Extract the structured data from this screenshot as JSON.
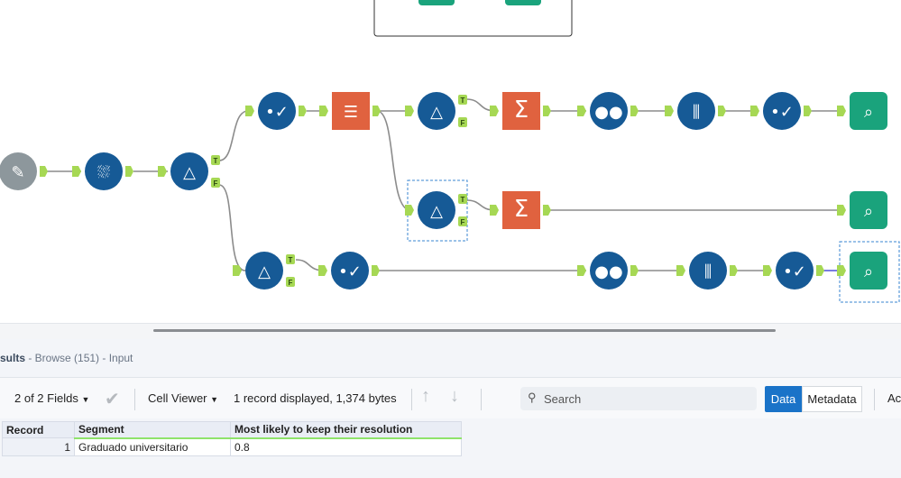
{
  "canvas": {
    "true_label": "T",
    "false_label": "F",
    "node_color": "#165a96",
    "accent_orange": "#e0623f",
    "browse_green": "#1aa37c",
    "connector_green": "#a6d854"
  },
  "results": {
    "title_bold": "sults",
    "title_rest": " - Browse (151) - Input",
    "fields_label": "2 of 2 Fields",
    "cell_viewer_label": "Cell Viewer",
    "record_info": "1 record displayed, 1,374 bytes",
    "search_placeholder": "Search",
    "data_tab": "Data",
    "metadata_tab": "Metadata",
    "actions_cut": "Ac",
    "table": {
      "headers": [
        "Record",
        "Segment",
        "Most likely to keep their resolution"
      ],
      "rows": [
        [
          "1",
          "Graduado universitario",
          "0.8"
        ]
      ]
    }
  }
}
